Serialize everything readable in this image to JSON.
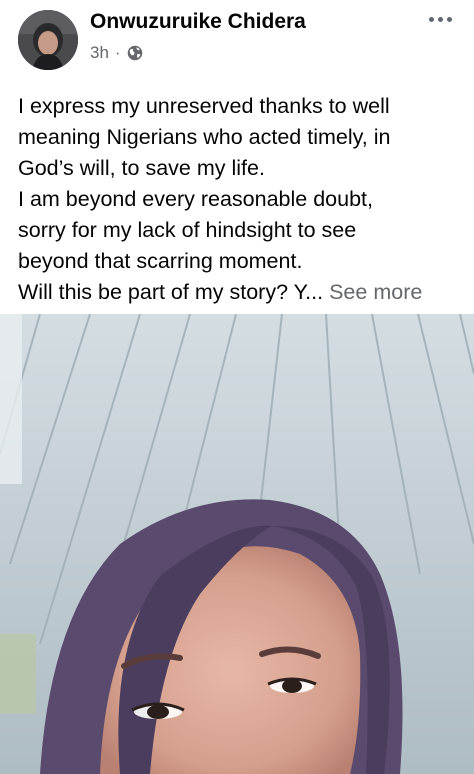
{
  "post": {
    "author": {
      "name": "Onwuzuruike Chidera",
      "avatar_icon": "profile-photo-avatar"
    },
    "time": "3h",
    "separator": "·",
    "privacy_icon": "globe-icon",
    "more_icon": "more-options-icon",
    "text_lines": [
      "I express my unreserved thanks to well",
      "meaning Nigerians who acted timely, in",
      "God’s will, to save my life.",
      "I am beyond every reasonable doubt,",
      "sorry for my lack of hindsight to see",
      "beyond that scarring moment.",
      "Will this be part of my story? Y..."
    ],
    "see_more_label": "See more",
    "photo": {
      "description_icon": "selfie-photo"
    }
  },
  "colors": {
    "text": "#050505",
    "secondary_text": "#65676b",
    "background": "#ffffff"
  }
}
